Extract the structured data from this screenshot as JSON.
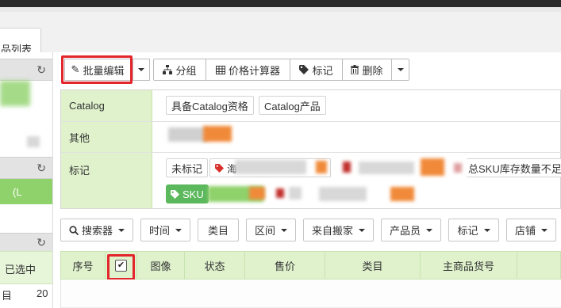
{
  "tab": {
    "label": "品列表"
  },
  "sidebar": {
    "selected_header": "已选中",
    "row_label": "目",
    "row_count": "20",
    "partial_label": "(L"
  },
  "toolbar": {
    "batch_edit": "批量编辑",
    "group": "分组",
    "price_calc": "价格计算器",
    "mark": "标记",
    "delete": "删除"
  },
  "filters": {
    "catalog": {
      "label": "Catalog",
      "tags": [
        "具备Catalog资格",
        "Catalog产品"
      ]
    },
    "other": {
      "label": "其他"
    },
    "marks": {
      "label": "标记",
      "tags": [
        "未标记",
        "海",
        "总SKU库存数量不足"
      ],
      "green_tag": "SKU"
    }
  },
  "filter_buttons": [
    "搜索器",
    "时间",
    "类目",
    "区间",
    "来自搬家",
    "产品员",
    "标记",
    "店铺"
  ],
  "grid": {
    "columns": [
      "序号",
      "",
      "图像",
      "状态",
      "售价",
      "类目",
      "主商品货号"
    ]
  },
  "colors": {
    "accent_green": "#5cb85c",
    "header_green": "#dff2cc",
    "highlight_red": "#e3262b"
  }
}
